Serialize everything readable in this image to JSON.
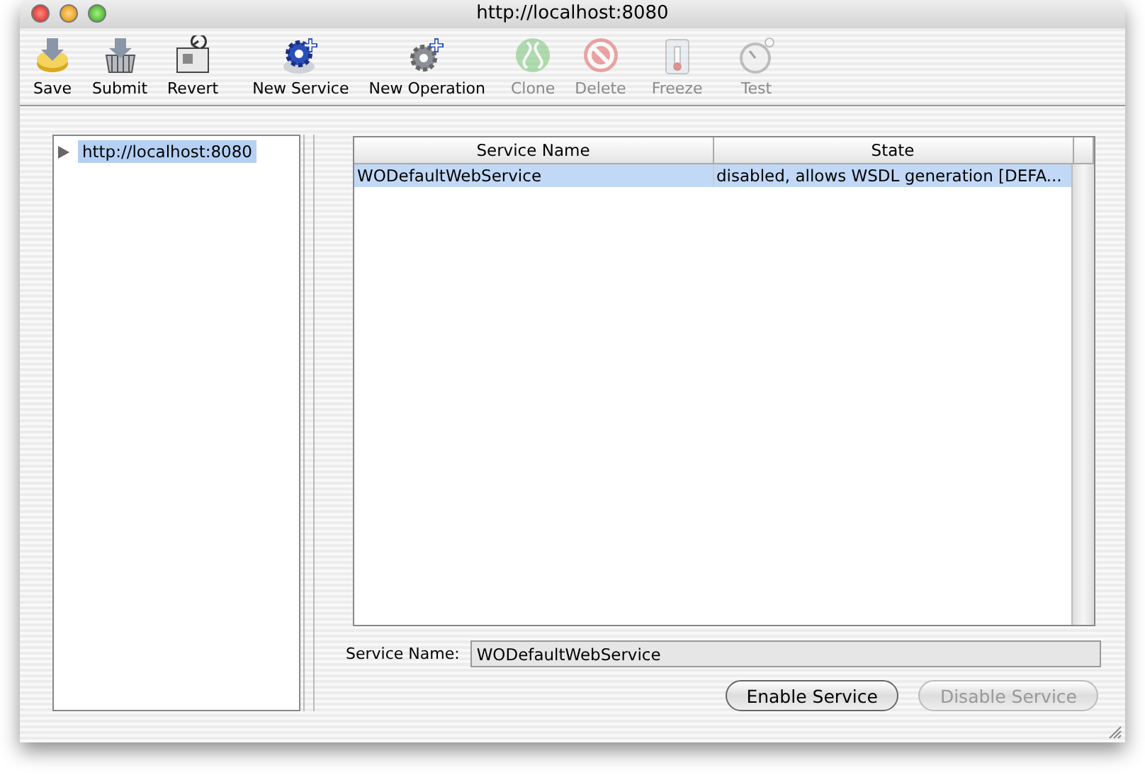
{
  "window": {
    "title": "http://localhost:8080"
  },
  "toolbar": [
    {
      "kind": "save",
      "label": "Save",
      "disabled": false
    },
    {
      "kind": "submit",
      "label": "Submit",
      "disabled": false
    },
    {
      "kind": "revert",
      "label": "Revert",
      "disabled": false
    },
    {
      "kind": "new-service",
      "label": "New Service",
      "disabled": false
    },
    {
      "kind": "new-operation",
      "label": "New Operation",
      "disabled": false
    },
    {
      "kind": "clone",
      "label": "Clone",
      "disabled": true
    },
    {
      "kind": "delete",
      "label": "Delete",
      "disabled": true
    },
    {
      "kind": "freeze",
      "label": "Freeze",
      "disabled": true
    },
    {
      "kind": "test",
      "label": "Test",
      "disabled": true
    }
  ],
  "tree": {
    "items": [
      {
        "label": "http://localhost:8080",
        "selected": true,
        "expanded": false
      }
    ]
  },
  "table": {
    "columns": [
      "Service Name",
      "State"
    ],
    "rows": [
      {
        "cells": [
          "WODefaultWebService",
          "disabled, allows WSDL generation [DEFA..."
        ],
        "selected": true
      }
    ]
  },
  "detail": {
    "label": "Service Name:",
    "value": "WODefaultWebService"
  },
  "buttons": [
    {
      "label": "Enable Service",
      "disabled": false
    },
    {
      "label": "Disable Service",
      "disabled": true
    }
  ]
}
